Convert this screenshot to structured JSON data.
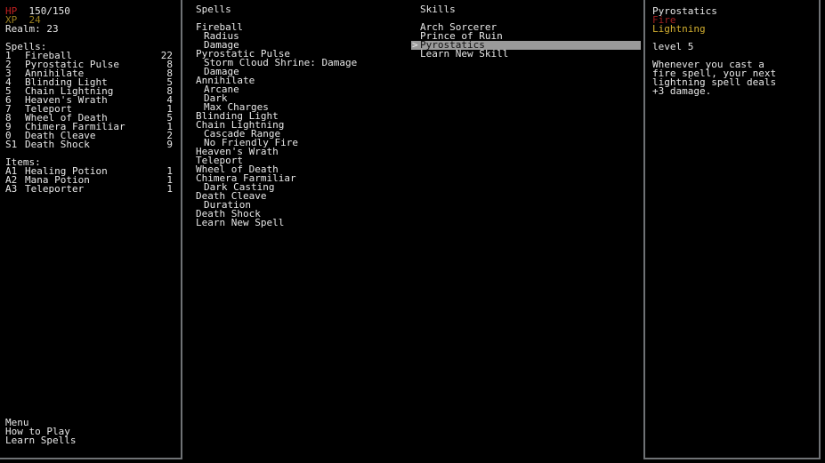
{
  "status": {
    "hp_label": "HP",
    "hp_value": "150/150",
    "xp_label": "XP",
    "xp_value": "24",
    "realm_line": "Realm: 23"
  },
  "spellbook": {
    "heading": "Spells:",
    "entries": [
      {
        "key": "1",
        "name": "Fireball",
        "count": "22"
      },
      {
        "key": "2",
        "name": "Pyrostatic Pulse",
        "count": "8"
      },
      {
        "key": "3",
        "name": "Annihilate",
        "count": "8"
      },
      {
        "key": "4",
        "name": "Blinding Light",
        "count": "5"
      },
      {
        "key": "5",
        "name": "Chain Lightning",
        "count": "8"
      },
      {
        "key": "6",
        "name": "Heaven's Wrath",
        "count": "4"
      },
      {
        "key": "7",
        "name": "Teleport",
        "count": "1"
      },
      {
        "key": "8",
        "name": "Wheel of Death",
        "count": "5"
      },
      {
        "key": "9",
        "name": "Chimera Farmiliar",
        "count": "1"
      },
      {
        "key": "0",
        "name": "Death Cleave",
        "count": "2"
      },
      {
        "key": "S1",
        "name": "Death Shock",
        "count": "9"
      }
    ]
  },
  "items": {
    "heading": "Items:",
    "entries": [
      {
        "key": "A1",
        "name": "Healing Potion",
        "count": "1"
      },
      {
        "key": "A2",
        "name": "Mana Potion",
        "count": "1"
      },
      {
        "key": "A3",
        "name": "Teleporter",
        "count": "1"
      }
    ]
  },
  "left_menu": {
    "items": [
      "Menu",
      "How to Play",
      "Learn Spells"
    ]
  },
  "spells_column": {
    "heading": "Spells",
    "nodes": [
      {
        "label": "Fireball",
        "level": 0
      },
      {
        "label": "Radius",
        "level": 1
      },
      {
        "label": "Damage",
        "level": 1
      },
      {
        "label": "Pyrostatic Pulse",
        "level": 0
      },
      {
        "label": "Storm Cloud Shrine: Damage",
        "level": 1
      },
      {
        "label": "Damage",
        "level": 1
      },
      {
        "label": "Annihilate",
        "level": 0
      },
      {
        "label": "Arcane",
        "level": 1
      },
      {
        "label": "Dark",
        "level": 1
      },
      {
        "label": "Max Charges",
        "level": 1
      },
      {
        "label": "Blinding Light",
        "level": 0
      },
      {
        "label": "Chain Lightning",
        "level": 0
      },
      {
        "label": "Cascade Range",
        "level": 1
      },
      {
        "label": "No Friendly Fire",
        "level": 1
      },
      {
        "label": "Heaven's Wrath",
        "level": 0
      },
      {
        "label": "Teleport",
        "level": 0
      },
      {
        "label": "Wheel of Death",
        "level": 0
      },
      {
        "label": "Chimera Farmiliar",
        "level": 0
      },
      {
        "label": "Dark Casting",
        "level": 1
      },
      {
        "label": "Death Cleave",
        "level": 0
      },
      {
        "label": "Duration",
        "level": 1
      },
      {
        "label": "Death Shock",
        "level": 0
      },
      {
        "label": "Learn New Spell",
        "level": 0
      }
    ]
  },
  "skills_column": {
    "heading": "Skills",
    "cursor_glyph": ">",
    "items": [
      {
        "label": "Arch Sorcerer",
        "selected": false
      },
      {
        "label": "Prince of Ruin",
        "selected": false
      },
      {
        "label": "Pyrostatics",
        "selected": true
      },
      {
        "label": "Learn New Skill",
        "selected": false
      }
    ]
  },
  "detail": {
    "title": "Pyrostatics",
    "tag_fire": "Fire",
    "tag_lightning": "Lightning",
    "level_line": "level 5",
    "description_lines": [
      "Whenever you cast a",
      "fire spell, your next",
      "lightning spell deals",
      "+3 damage."
    ]
  },
  "colors": {
    "hp": "#c02020",
    "xp": "#9a8020",
    "fire": "#a02020",
    "lightning": "#d4b030",
    "highlight": "#9a9a9a",
    "border": "#6f7275",
    "text": "#e8e8e8",
    "background": "#000000"
  }
}
